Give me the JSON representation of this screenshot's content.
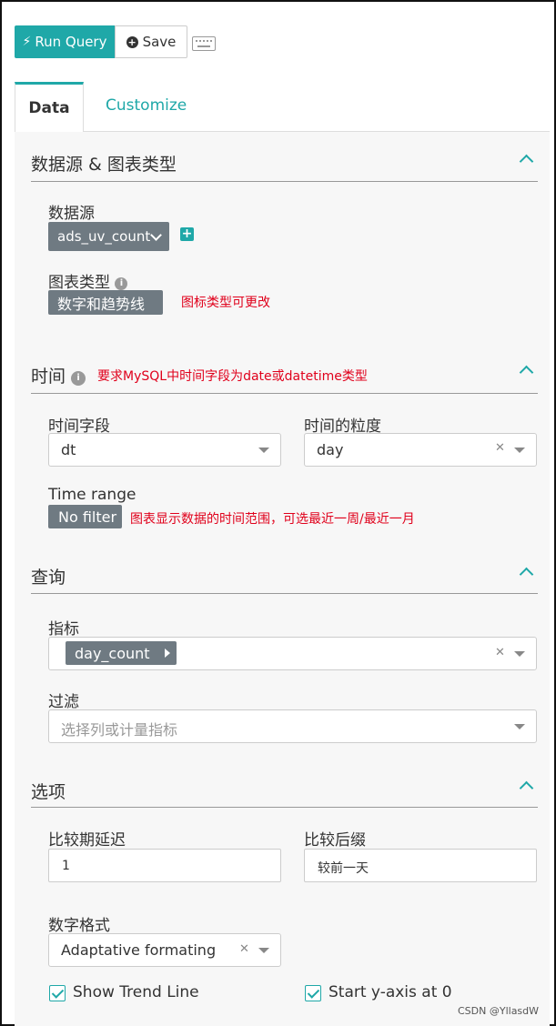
{
  "toolbar": {
    "run_label": "Run Query",
    "save_label": "Save"
  },
  "tabs": {
    "data": "Data",
    "customize": "Customize"
  },
  "datasource_section": {
    "title": "数据源 & 图表类型",
    "datasource_label": "数据源",
    "datasource_value": "ads_uv_count",
    "chart_type_label": "图表类型",
    "chart_type_value": "数字和趋势线",
    "chart_type_note": "图标类型可更改"
  },
  "time_section": {
    "title": "时间",
    "note": "要求MySQL中时间字段为date或datetime类型",
    "time_column_label": "时间字段",
    "time_column_value": "dt",
    "granularity_label": "时间的粒度",
    "granularity_value": "day",
    "time_range_label": "Time range",
    "time_range_value": "No filter",
    "time_range_note": "图表显示数据的时间范围，可选最近一周/最近一月"
  },
  "query_section": {
    "title": "查询",
    "metric_label": "指标",
    "metric_value": "day_count",
    "filter_label": "过滤",
    "filter_placeholder": "选择列或计量指标"
  },
  "options_section": {
    "title": "选项",
    "comparison_lag_label": "比较期延迟",
    "comparison_lag_value": "1",
    "comparison_suffix_label": "比较后缀",
    "comparison_suffix_value": "较前一天",
    "number_format_label": "数字格式",
    "number_format_value": "Adaptative formating",
    "show_trend_line_label": "Show Trend Line",
    "start_y_axis_zero_label": "Start y-axis at 0"
  },
  "watermark": "CSDN @YllasdW",
  "colors": {
    "accent": "#1fa8a8",
    "pill_gray": "#6f7a82",
    "note_red": "#e0001b"
  }
}
